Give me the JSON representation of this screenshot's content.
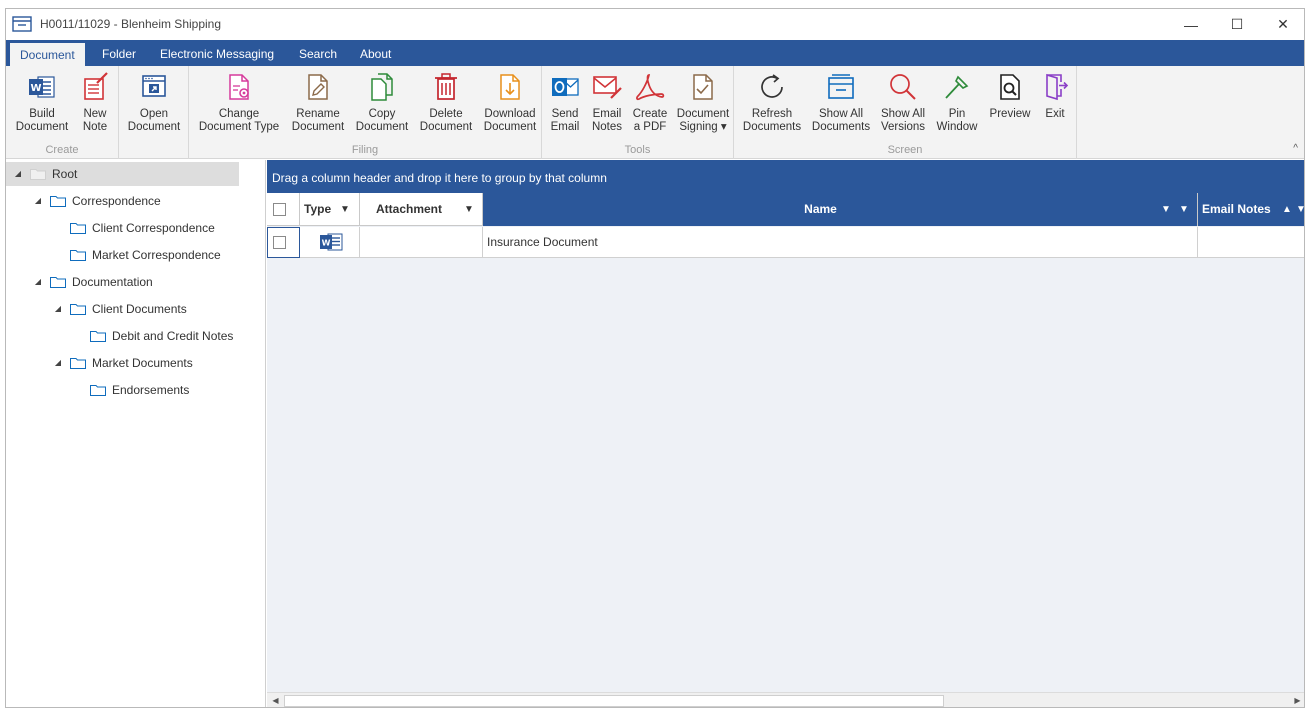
{
  "window": {
    "title": "H0011/11029 - Blenheim Shipping",
    "minimize_glyph": "—",
    "maximize_glyph": "☐",
    "close_glyph": "✕"
  },
  "ribbon": {
    "tabs": [
      {
        "label": "Document",
        "active": true
      },
      {
        "label": "Folder"
      },
      {
        "label": "Electronic Messaging"
      },
      {
        "label": "Search"
      },
      {
        "label": "About"
      }
    ],
    "groups": {
      "create": {
        "label": "Create",
        "buttons": [
          {
            "line1": "Build",
            "line2": "Document",
            "icon": "word-icon"
          },
          {
            "line1": "New",
            "line2": "Note",
            "icon": "new-note-icon"
          }
        ]
      },
      "open": {
        "buttons": [
          {
            "line1": "Open",
            "line2": "Document",
            "icon": "open-document-icon"
          }
        ]
      },
      "filing": {
        "label": "Filing",
        "buttons": [
          {
            "line1": "Change",
            "line2": "Document Type",
            "icon": "change-type-icon"
          },
          {
            "line1": "Rename",
            "line2": "Document",
            "icon": "rename-icon"
          },
          {
            "line1": "Copy",
            "line2": "Document",
            "icon": "copy-icon"
          },
          {
            "line1": "Delete",
            "line2": "Document",
            "icon": "delete-icon"
          },
          {
            "line1": "Download",
            "line2": "Document",
            "icon": "download-icon"
          }
        ]
      },
      "tools": {
        "label": "Tools",
        "buttons": [
          {
            "line1": "Send",
            "line2": "Email",
            "icon": "outlook-icon"
          },
          {
            "line1": "Email",
            "line2": "Notes",
            "icon": "email-notes-icon"
          },
          {
            "line1": "Create",
            "line2": "a PDF",
            "icon": "pdf-icon"
          },
          {
            "line1": "Document",
            "line2": "Signing ▾",
            "icon": "document-signing-icon"
          }
        ]
      },
      "screen": {
        "label": "Screen",
        "buttons": [
          {
            "line1": "Refresh",
            "line2": "Documents",
            "icon": "refresh-icon"
          },
          {
            "line1": "Show All",
            "line2": "Documents",
            "icon": "show-all-documents-icon"
          },
          {
            "line1": "Show All",
            "line2": "Versions",
            "icon": "search-icon"
          },
          {
            "line1": "Pin",
            "line2": "Window",
            "icon": "pin-icon"
          },
          {
            "line1": "Preview",
            "line2": "",
            "icon": "preview-icon"
          },
          {
            "line1": "Exit",
            "line2": "",
            "icon": "exit-icon"
          }
        ]
      }
    },
    "collapse_glyph": "^"
  },
  "tree": {
    "nodes": [
      {
        "label": "Root",
        "level": 0,
        "expanded": true,
        "selected": true
      },
      {
        "label": "Correspondence",
        "level": 1,
        "expanded": true
      },
      {
        "label": "Client Correspondence",
        "level": 2
      },
      {
        "label": "Market Correspondence",
        "level": 2
      },
      {
        "label": "Documentation",
        "level": 1,
        "expanded": true
      },
      {
        "label": "Client Documents",
        "level": 2,
        "expanded": true
      },
      {
        "label": "Debit and Credit Notes",
        "level": 3
      },
      {
        "label": "Market Documents",
        "level": 2,
        "expanded": true
      },
      {
        "label": "Endorsements",
        "level": 3
      }
    ]
  },
  "grid": {
    "group_panel_text": "Drag a column header and drop it here to group by that column",
    "columns": {
      "type": "Type",
      "attachment": "Attachment",
      "name": "Name",
      "email_notes": "Email Notes"
    },
    "sort_indicator_name": "▼",
    "sort_indicator_email": "▲",
    "filter_glyph": "▼",
    "rows": [
      {
        "type_icon": "word-icon",
        "attachment": "",
        "name": "Insurance Document",
        "email_notes": ""
      }
    ]
  },
  "colors": {
    "accent": "#2b579a",
    "ribbon_bg": "#f3f3f3",
    "grid_bg": "#eef1f6"
  }
}
